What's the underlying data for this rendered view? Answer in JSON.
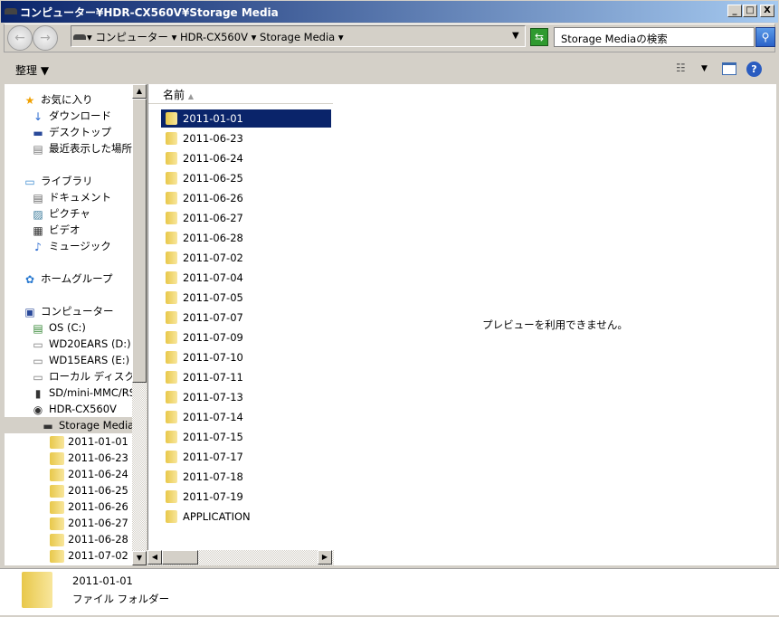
{
  "window": {
    "title": "コンピューター¥HDR-CX560V¥Storage Media",
    "min": "_",
    "max": "□",
    "close": "X"
  },
  "address": {
    "crumbs": [
      "コンピューター",
      "HDR-CX560V",
      "Storage Media"
    ],
    "search_placeholder": "Storage Mediaの検索"
  },
  "toolbar": {
    "organize": "整理 ▼"
  },
  "nav": [
    {
      "label": "お気に入り",
      "icon": "star-icon",
      "level": 1
    },
    {
      "label": "ダウンロード",
      "icon": "downloads-icon",
      "level": 2
    },
    {
      "label": "デスクトップ",
      "icon": "desktop-icon",
      "level": 2
    },
    {
      "label": "最近表示した場所",
      "icon": "recent-places-icon",
      "level": 2
    },
    {
      "gap": true
    },
    {
      "label": "ライブラリ",
      "icon": "libraries-icon",
      "level": 1
    },
    {
      "label": "ドキュメント",
      "icon": "documents-icon",
      "level": 2
    },
    {
      "label": "ピクチャ",
      "icon": "pictures-icon",
      "level": 2
    },
    {
      "label": "ビデオ",
      "icon": "videos-icon",
      "level": 2
    },
    {
      "label": "ミュージック",
      "icon": "music-icon",
      "level": 2
    },
    {
      "gap": true
    },
    {
      "label": "ホームグループ",
      "icon": "homegroup-icon",
      "level": 1
    },
    {
      "gap": true
    },
    {
      "label": "コンピューター",
      "icon": "computer-icon",
      "level": 1
    },
    {
      "label": "OS (C:)",
      "icon": "drive-c-icon",
      "level": 2
    },
    {
      "label": "WD20EARS (D:)",
      "icon": "drive-icon",
      "level": 2
    },
    {
      "label": "WD15EARS (E:)",
      "icon": "drive-icon",
      "level": 2
    },
    {
      "label": "ローカル ディスク (G:)",
      "icon": "drive-icon",
      "level": 2
    },
    {
      "label": "SD/mini-MMC/RS",
      "icon": "sd-card-icon",
      "level": 2
    },
    {
      "label": "HDR-CX560V",
      "icon": "camera-icon",
      "level": 2
    },
    {
      "label": "Storage Media",
      "icon": "storage-icon",
      "level": 3,
      "selected": true
    },
    {
      "label": "2011-01-01",
      "icon": "folder-icon",
      "level": 4
    },
    {
      "label": "2011-06-23",
      "icon": "folder-icon",
      "level": 4
    },
    {
      "label": "2011-06-24",
      "icon": "folder-icon",
      "level": 4
    },
    {
      "label": "2011-06-25",
      "icon": "folder-icon",
      "level": 4
    },
    {
      "label": "2011-06-26",
      "icon": "folder-icon",
      "level": 4
    },
    {
      "label": "2011-06-27",
      "icon": "folder-icon",
      "level": 4
    },
    {
      "label": "2011-06-28",
      "icon": "folder-icon",
      "level": 4
    },
    {
      "label": "2011-07-02",
      "icon": "folder-icon",
      "level": 4
    }
  ],
  "list": {
    "header": "名前",
    "items": [
      "2011-01-01",
      "2011-06-23",
      "2011-06-24",
      "2011-06-25",
      "2011-06-26",
      "2011-06-27",
      "2011-06-28",
      "2011-07-02",
      "2011-07-04",
      "2011-07-05",
      "2011-07-07",
      "2011-07-09",
      "2011-07-10",
      "2011-07-11",
      "2011-07-13",
      "2011-07-14",
      "2011-07-15",
      "2011-07-17",
      "2011-07-18",
      "2011-07-19",
      "APPLICATION"
    ],
    "selected_index": 0
  },
  "preview": {
    "text": "プレビューを利用できません。"
  },
  "details": {
    "name": "2011-01-01",
    "type": "ファイル フォルダー"
  }
}
